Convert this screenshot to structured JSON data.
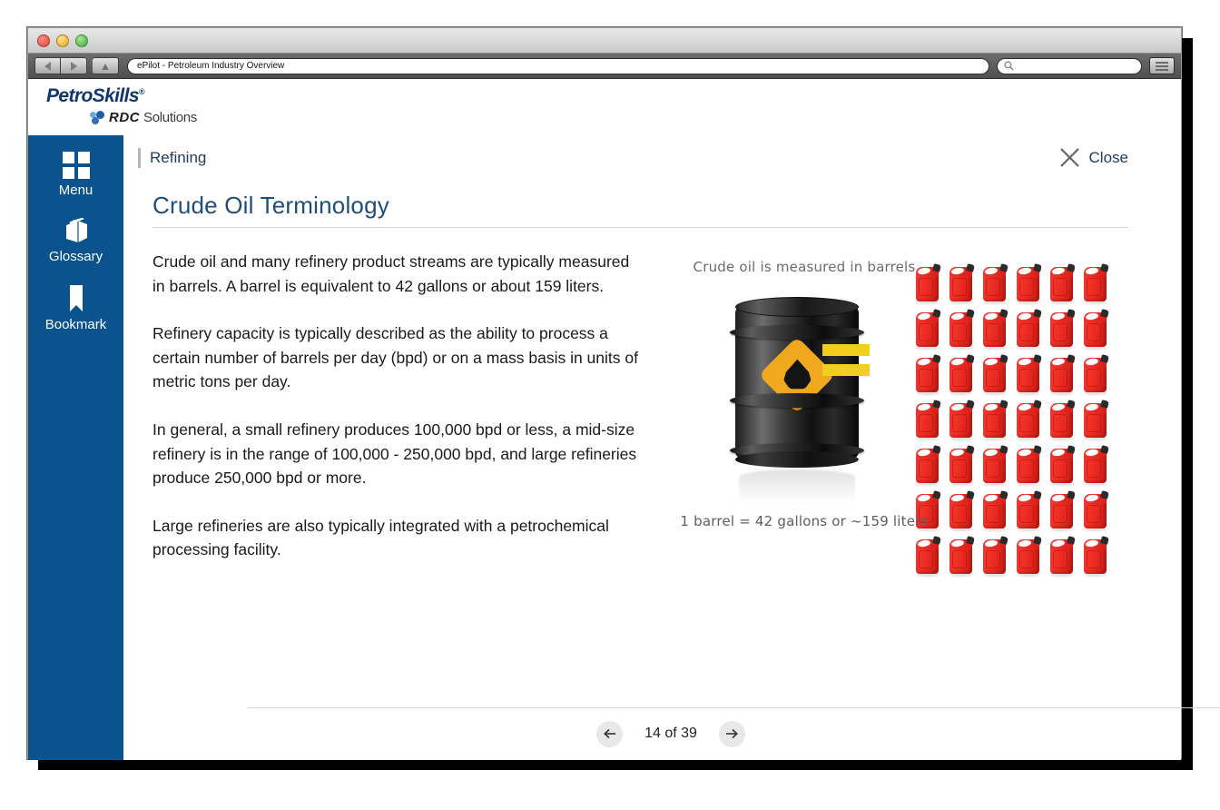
{
  "browser": {
    "window_title": "ePilot - Petroleum Industry Overview",
    "url_value": "ePilot - Petroleum Industry Overview",
    "search_placeholder": "",
    "back_icon": "back-arrow-icon",
    "forward_icon": "forward-arrow-icon",
    "home_icon": "home-icon",
    "search_icon": "search-icon",
    "menu_icon": "hamburger-menu-icon",
    "traffic_lights": [
      "close-red",
      "minimize-yellow",
      "zoom-green"
    ]
  },
  "brand": {
    "name": "PetroSkills",
    "registered_mark": "®",
    "sub_mark": "RDC",
    "sub_name": "Solutions",
    "color": "#12366b"
  },
  "sidebar": {
    "background": "#0a538f",
    "items": [
      {
        "label": "Menu",
        "icon": "grid-menu-icon"
      },
      {
        "label": "Glossary",
        "icon": "book-icon"
      },
      {
        "label": "Bookmark",
        "icon": "bookmark-icon"
      }
    ]
  },
  "topbar": {
    "breadcrumb": "Refining",
    "close_label": "Close",
    "close_icon": "close-x-icon"
  },
  "page": {
    "title": "Crude Oil Terminology",
    "title_color": "#1f4e79",
    "paragraphs": [
      "Crude oil and many refinery product streams are typically measured in barrels. A barrel is equivalent to 42 gallons or about 159 liters.",
      "Refinery capacity is typically described as the ability to process a certain number of barrels per day (bpd) or on a mass basis in units of metric tons per day.",
      "In general, a small refinery produces 100,000 bpd or less, a mid-size refinery is in the range of 100,000 - 250,000 bpd, and large refineries produce 250,000 bpd or more.",
      "Large refineries are also typically integrated with a petrochemical processing facility."
    ]
  },
  "illustration": {
    "caption_top": "Crude oil is measured in barrels",
    "caption_bottom": "1 barrel = 42 gallons or ~159 liters",
    "barrel_icon": "oil-barrel-icon",
    "barrel_logo_icon": "oil-drop-diamond-icon",
    "equals_icon": "equals-sign-icon",
    "can_icon": "red-gas-can-icon",
    "cans_rows": 7,
    "cans_columns": 6,
    "cans_total": 42,
    "barrel_color": "#1a1a1a",
    "logo_color": "#f0a81e",
    "equals_color": "#f2cf1f",
    "can_color": "#ef2e24"
  },
  "footer": {
    "page_indicator": "14 of 39",
    "current_page": 14,
    "total_pages": 39,
    "prev_icon": "arrow-left-icon",
    "next_icon": "arrow-right-icon"
  }
}
